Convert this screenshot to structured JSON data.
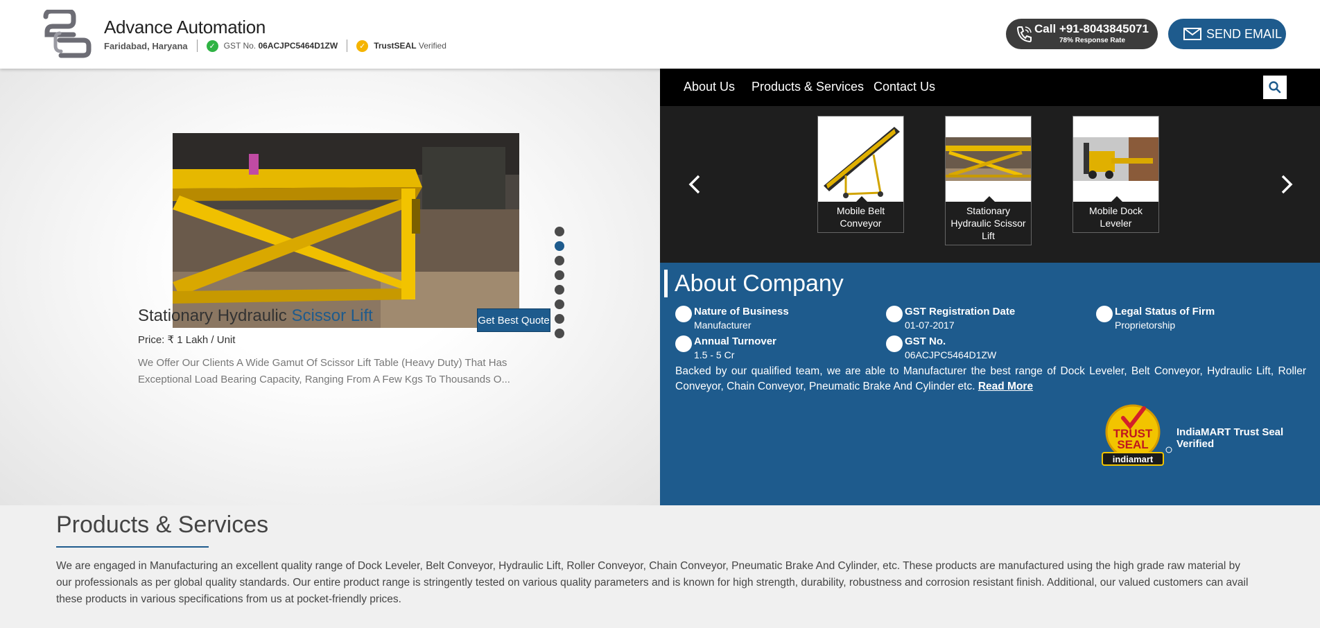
{
  "header": {
    "company_name": "Advance Automation",
    "location": "Faridabad, Haryana",
    "gst_label": "GST No.",
    "gst_number": "06ACJPC5464D1ZW",
    "trustseal_label": "TrustSEAL",
    "trustseal_status": "Verified",
    "call_label": "Call +91-8043845071",
    "response_rate": "78% Response Rate",
    "email_label": "SEND EMAIL"
  },
  "featured_product": {
    "title_main": "Stationary Hydraulic",
    "title_highlight": "Scissor Lift",
    "price": "Price: ₹ 1 Lakh / Unit",
    "description": "We Offer Our Clients A Wide Gamut Of Scissor Lift Table (Heavy Duty) That Has Exceptional Load Bearing Capacity, Ranging From A Few Kgs To Thousands O...",
    "quote_button": "Get Best Quote",
    "slide_count": 8,
    "active_slide": 2
  },
  "nav": {
    "items": [
      "About Us",
      "Products & Services",
      "Contact Us"
    ]
  },
  "carousel": {
    "items": [
      {
        "label": "Mobile Belt Conveyor"
      },
      {
        "label": "Stationary Hydraulic Scissor Lift"
      },
      {
        "label": "Mobile Dock Leveler"
      }
    ]
  },
  "about": {
    "title": "About Company",
    "facts": [
      {
        "key": "Nature of Business",
        "value": "Manufacturer",
        "icon": "business-icon"
      },
      {
        "key": "GST Registration Date",
        "value": "01-07-2017",
        "icon": "calendar-icon"
      },
      {
        "key": "Legal Status of Firm",
        "value": "Proprietorship",
        "icon": "scale-icon"
      },
      {
        "key": "Annual Turnover",
        "value": "1.5 - 5 Cr",
        "icon": "chart-icon"
      },
      {
        "key": "GST No.",
        "value": "06ACJPC5464D1ZW",
        "icon": "document-icon"
      }
    ],
    "text": "Backed by our qualified team, we are able to Manufacturer the best range of Dock Leveler, Belt Conveyor, Hydraulic Lift, Roller Conveyor, Chain Conveyor, Pneumatic Brake And Cylinder etc.",
    "read_more": "Read More",
    "badge_line1": "TRUST",
    "badge_line2": "SEAL",
    "badge_line3": "indiamart",
    "trust_text": "IndiaMART Trust Seal Verified"
  },
  "products_services": {
    "title": "Products & Services",
    "text": "We are engaged in Manufacturing an excellent quality range of Dock Leveler, Belt Conveyor, Hydraulic Lift, Roller Conveyor, Chain Conveyor, Pneumatic Brake And Cylinder, etc. These products are manufactured using the high grade raw material by our professionals as per global quality standards. Our entire product range is stringently tested on various quality parameters and is known for high strength, durability, robustness and corrosion resistant finish. Additional, our valued customers can avail these products in various specifications from us at pocket-friendly prices."
  },
  "colors": {
    "brand_blue": "#1e5b8d",
    "dark_gray": "#3c3c3c",
    "check_green": "#2fb344",
    "seal_yellow": "#f5b400"
  }
}
